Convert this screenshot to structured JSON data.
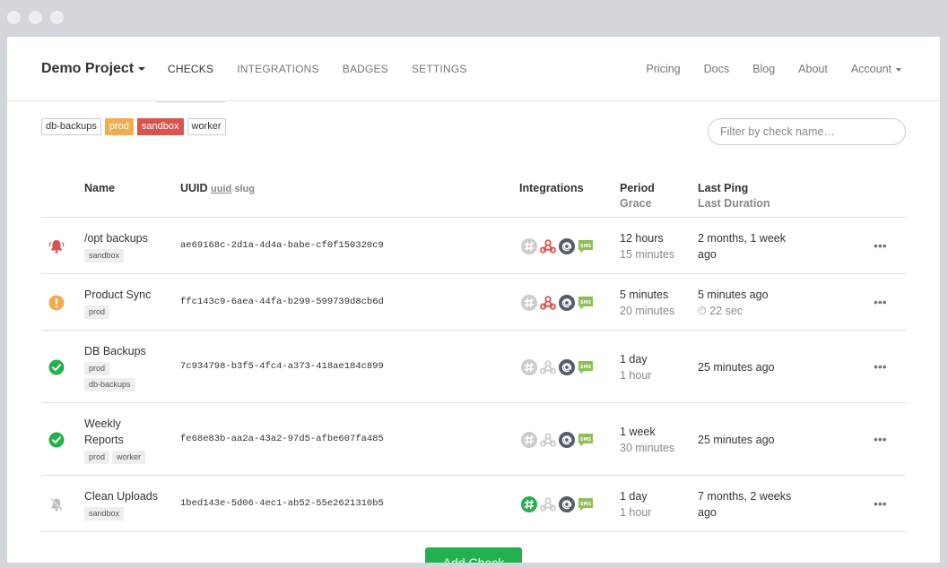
{
  "navbar": {
    "project": "Demo Project",
    "left_links": [
      "CHECKS",
      "INTEGRATIONS",
      "BADGES",
      "SETTINGS"
    ],
    "right_links": [
      "Pricing",
      "Docs",
      "Blog",
      "About"
    ],
    "account": "Account"
  },
  "tags": [
    {
      "label": "db-backups",
      "style": "default"
    },
    {
      "label": "prod",
      "style": "orange"
    },
    {
      "label": "sandbox",
      "style": "red"
    },
    {
      "label": "worker",
      "style": "default"
    }
  ],
  "filter": {
    "placeholder": "Filter by check name…"
  },
  "headers": {
    "name": "Name",
    "uuid": "UUID",
    "uuid_toggle": "uuid",
    "slug_toggle": "slug",
    "integrations": "Integrations",
    "period": "Period",
    "grace": "Grace",
    "last_ping": "Last Ping",
    "last_duration": "Last Duration"
  },
  "checks": [
    {
      "status": "down",
      "name": "/opt backups",
      "tags": [
        "sandbox"
      ],
      "uuid": "ae69168c-2d1a-4d4a-babe-cf0f150320c9",
      "integrations": {
        "slack": false,
        "webhook": true,
        "email": true,
        "sms": true
      },
      "period": "12 hours",
      "grace": "15 minutes",
      "last_ping": "2 months, 1 week ago",
      "last_duration": ""
    },
    {
      "status": "grace",
      "name": "Product Sync",
      "tags": [
        "prod"
      ],
      "uuid": "ffc143c9-6aea-44fa-b299-599739d8cb6d",
      "integrations": {
        "slack": false,
        "webhook": true,
        "email": true,
        "sms": true
      },
      "period": "5 minutes",
      "grace": "20 minutes",
      "last_ping": "5 minutes ago",
      "last_duration": "⏱ 22 sec"
    },
    {
      "status": "up",
      "name": "DB Backups",
      "tags": [
        "prod",
        "db-backups"
      ],
      "uuid": "7c934798-b3f5-4fc4-a373-418ae184c899",
      "integrations": {
        "slack": false,
        "webhook": false,
        "email": true,
        "sms": true
      },
      "period": "1 day",
      "grace": "1 hour",
      "last_ping": "25 minutes ago",
      "last_duration": ""
    },
    {
      "status": "up",
      "name": "Weekly Reports",
      "tags": [
        "prod",
        "worker"
      ],
      "uuid": "fe68e83b-aa2a-43a2-97d5-afbe607fa485",
      "integrations": {
        "slack": false,
        "webhook": false,
        "email": true,
        "sms": true
      },
      "period": "1 week",
      "grace": "30 minutes",
      "last_ping": "25 minutes ago",
      "last_duration": ""
    },
    {
      "status": "paused",
      "name": "Clean Uploads",
      "tags": [
        "sandbox"
      ],
      "uuid": "1bed143e-5d06-4ec1-ab52-55e2621310b5",
      "integrations": {
        "slack": true,
        "webhook": false,
        "email": true,
        "sms": true
      },
      "period": "1 day",
      "grace": "1 hour",
      "last_ping": "7 months, 2 weeks ago",
      "last_duration": ""
    }
  ],
  "add_check_label": "Add Check",
  "colors": {
    "up": "#22b14c",
    "grace": "#f0ad4e",
    "down": "#d9534f",
    "paused": "#bbbbbb",
    "webhook_active": "#d9534f",
    "email": "#555c6a",
    "sms": "#8cc152",
    "slack_active": "#22b14c",
    "inactive": "#cccccc"
  }
}
